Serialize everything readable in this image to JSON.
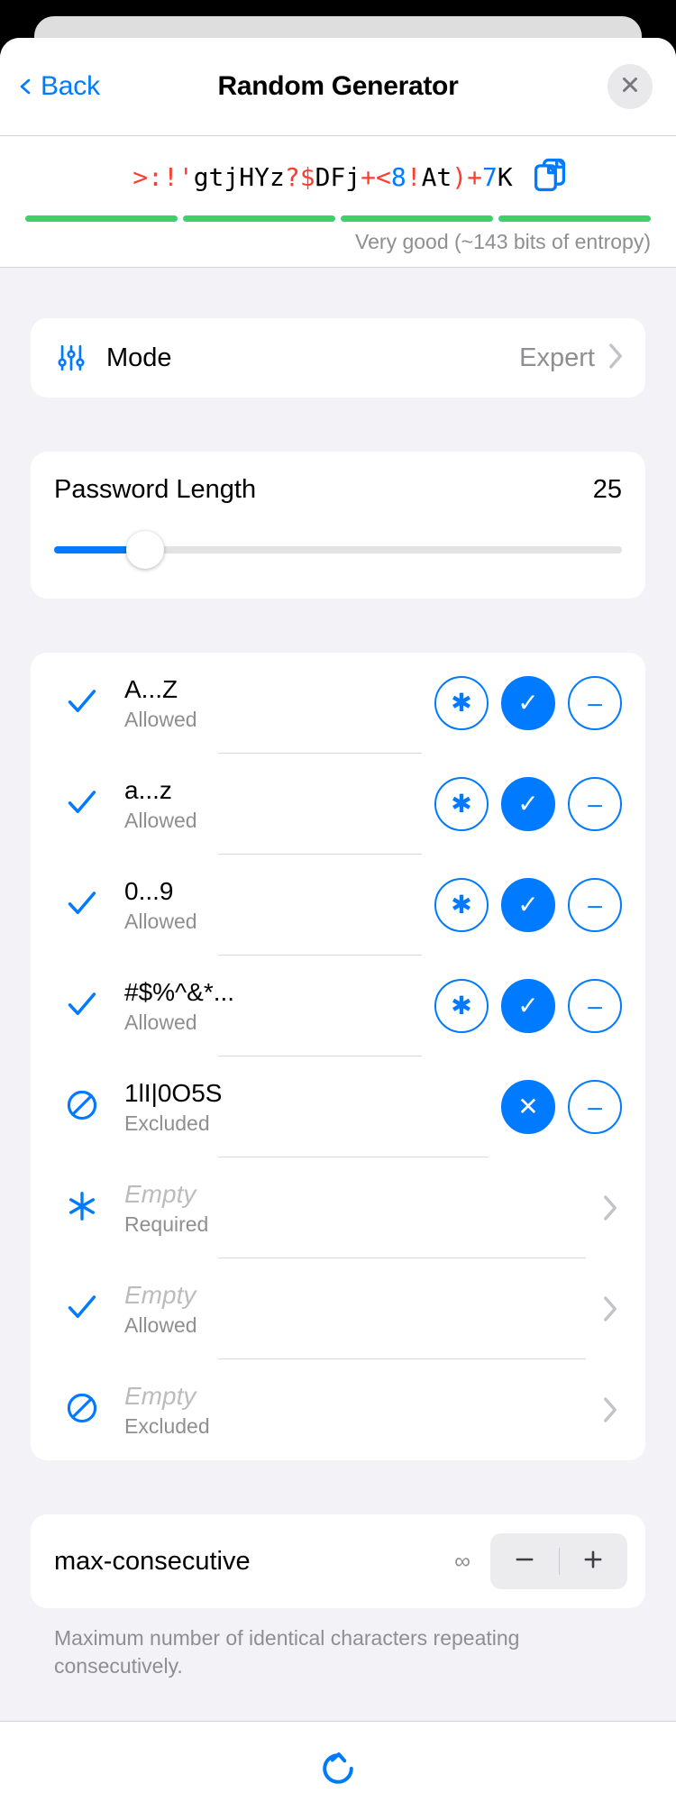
{
  "window": {
    "backdrop_color": "#000000",
    "sheet_background": "#f2f2f7",
    "accent_color": "#007aff",
    "strength_color": "#3ed06a"
  },
  "navbar": {
    "back_label": "Back",
    "title": "Random Generator",
    "close_icon": "close-icon",
    "back_icon": "chevron-left-icon"
  },
  "password": {
    "value": ">:!'gtjHYz?$DFj+<8!At)+7K",
    "segments": [
      {
        "text": ">:!'",
        "kind": "sym"
      },
      {
        "text": "gtjHYz",
        "kind": "let"
      },
      {
        "text": "?$",
        "kind": "sym"
      },
      {
        "text": "DFj",
        "kind": "let"
      },
      {
        "text": "+<",
        "kind": "sym"
      },
      {
        "text": "8",
        "kind": "num"
      },
      {
        "text": "!",
        "kind": "sym"
      },
      {
        "text": "At",
        "kind": "let"
      },
      {
        "text": ")+",
        "kind": "sym"
      },
      {
        "text": "7",
        "kind": "num"
      },
      {
        "text": "K",
        "kind": "let"
      }
    ],
    "copy_icon": "copy-icon",
    "strength_label": "Very good (~143 bits of entropy)",
    "strength_segments_total": 4,
    "strength_segments_filled": 4
  },
  "mode": {
    "icon": "sliders-icon",
    "label": "Mode",
    "value": "Expert",
    "chevron_icon": "chevron-right-icon"
  },
  "length": {
    "label": "Password Length",
    "value": "25",
    "percent": 16
  },
  "charsets": {
    "rows": [
      {
        "lead_icon": "check-icon",
        "title": "A...Z",
        "subtitle": "Allowed",
        "title_empty": false,
        "actions": [
          {
            "name": "required-button",
            "glyph": "✱",
            "state": "off"
          },
          {
            "name": "allowed-button",
            "glyph": "✓",
            "state": "on"
          },
          {
            "name": "excluded-button",
            "glyph": "–",
            "state": "off"
          }
        ]
      },
      {
        "lead_icon": "check-icon",
        "title": "a...z",
        "subtitle": "Allowed",
        "title_empty": false,
        "actions": [
          {
            "name": "required-button",
            "glyph": "✱",
            "state": "off"
          },
          {
            "name": "allowed-button",
            "glyph": "✓",
            "state": "on"
          },
          {
            "name": "excluded-button",
            "glyph": "–",
            "state": "off"
          }
        ]
      },
      {
        "lead_icon": "check-icon",
        "title": "0...9",
        "subtitle": "Allowed",
        "title_empty": false,
        "actions": [
          {
            "name": "required-button",
            "glyph": "✱",
            "state": "off"
          },
          {
            "name": "allowed-button",
            "glyph": "✓",
            "state": "on"
          },
          {
            "name": "excluded-button",
            "glyph": "–",
            "state": "off"
          }
        ]
      },
      {
        "lead_icon": "check-icon",
        "title": "#$%^&*...",
        "subtitle": "Allowed",
        "title_empty": false,
        "actions": [
          {
            "name": "required-button",
            "glyph": "✱",
            "state": "off"
          },
          {
            "name": "allowed-button",
            "glyph": "✓",
            "state": "on"
          },
          {
            "name": "excluded-button",
            "glyph": "–",
            "state": "off"
          }
        ]
      },
      {
        "lead_icon": "no-entry-icon",
        "title": "1lI|0O5S",
        "subtitle": "Excluded",
        "title_empty": false,
        "actions": [
          {
            "name": "excluded-active-button",
            "glyph": "✕",
            "state": "on"
          },
          {
            "name": "excluded-button",
            "glyph": "–",
            "state": "off"
          }
        ]
      },
      {
        "lead_icon": "asterisk-icon",
        "title": "Empty",
        "subtitle": "Required",
        "title_empty": true,
        "chevron": true
      },
      {
        "lead_icon": "check-icon",
        "title": "Empty",
        "subtitle": "Allowed",
        "title_empty": true,
        "chevron": true
      },
      {
        "lead_icon": "no-entry-icon",
        "title": "Empty",
        "subtitle": "Excluded",
        "title_empty": true,
        "chevron": true
      }
    ]
  },
  "max_consecutive": {
    "label": "max-consecutive",
    "value": "∞",
    "minus_label": "−",
    "plus_label": "+",
    "footnote": "Maximum number of identical characters repeating consecutively."
  },
  "bottom": {
    "refresh_icon": "refresh-icon"
  }
}
